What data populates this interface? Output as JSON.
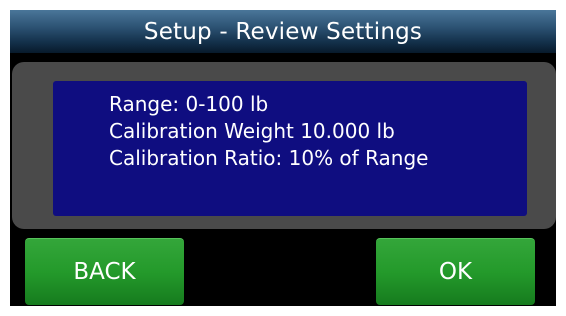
{
  "header": {
    "title": "Setup - Review Settings"
  },
  "settings": {
    "lines": [
      "Range: 0-100 lb",
      "Calibration Weight 10.000 lb",
      "Calibration Ratio: 10% of Range"
    ]
  },
  "buttons": {
    "back_label": "BACK",
    "ok_label": "OK"
  },
  "colors": {
    "info_background": "#0f0d80",
    "button_green": "#249a2b",
    "panel_gray": "#4a4a4a",
    "title_bar": "#13304a"
  }
}
